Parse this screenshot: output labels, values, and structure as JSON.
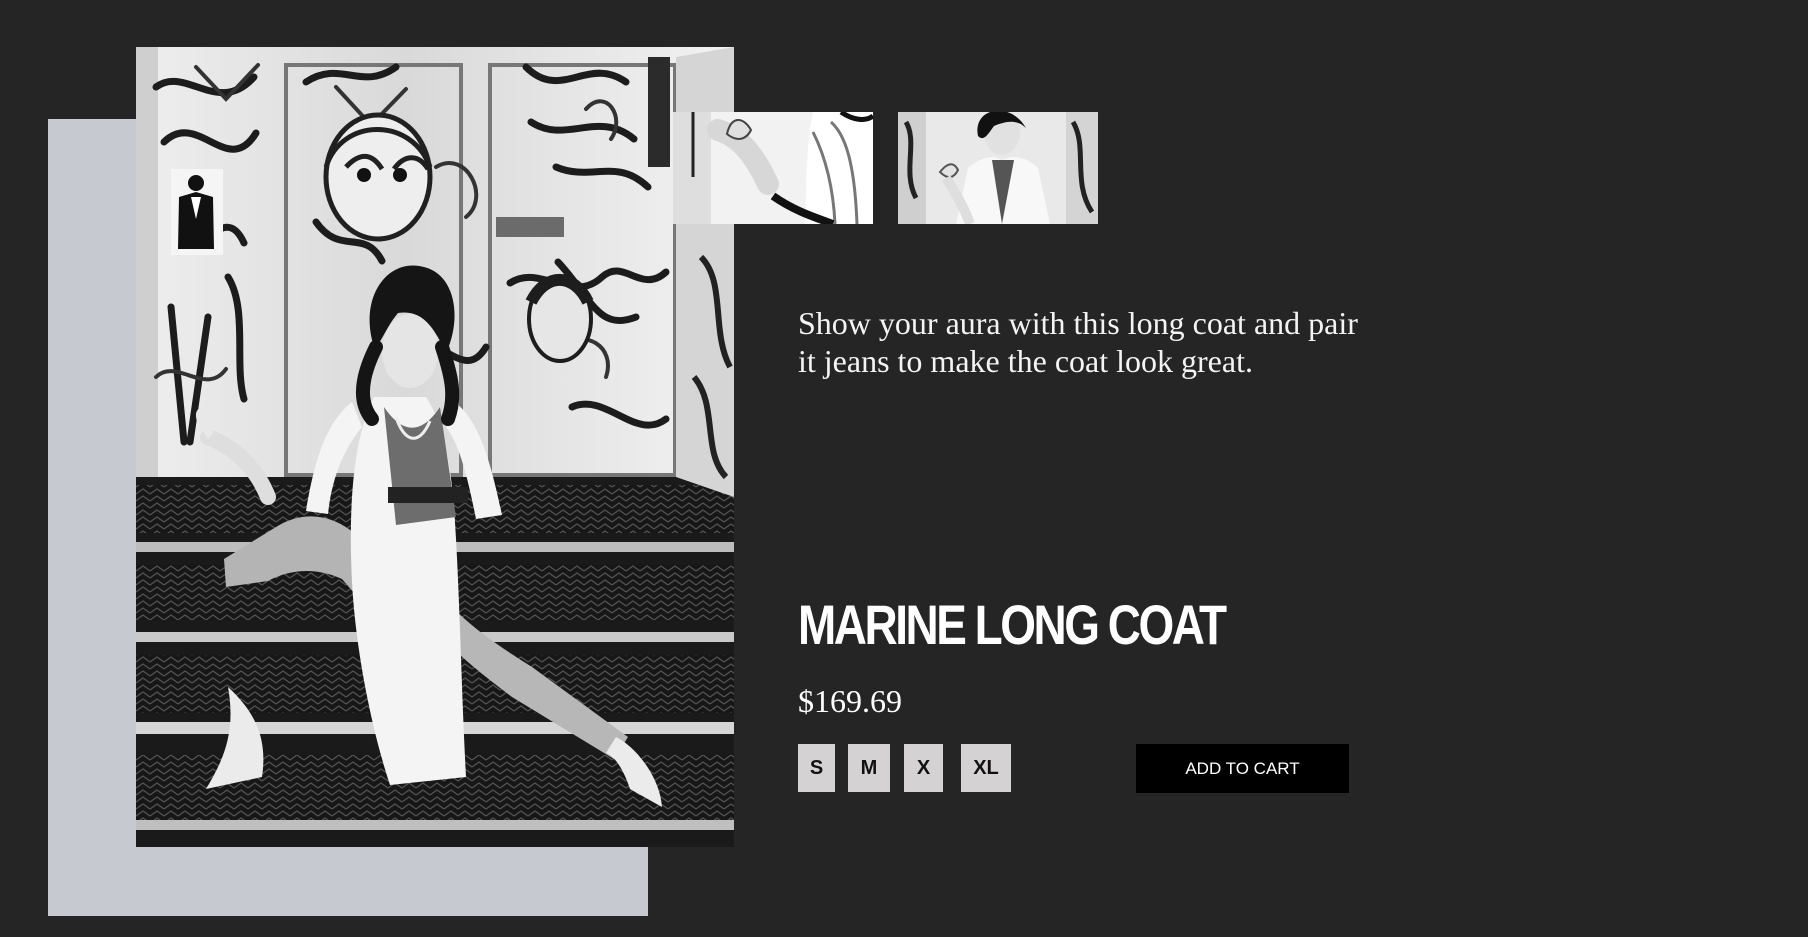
{
  "product": {
    "description": "Show your aura with this long coat and pair it jeans to make the coat look great.",
    "title": "MARINE LONG COAT",
    "price": "$169.69"
  },
  "sizes": [
    "S",
    "M",
    "X",
    "XL"
  ],
  "actions": {
    "add_to_cart": "ADD TO CART"
  },
  "colors": {
    "page_background": "#252525",
    "photo_backdrop": "#c6c9cf",
    "size_button_background": "#d4d2d3",
    "cart_button_background": "#000000",
    "text": "#ffffff"
  }
}
